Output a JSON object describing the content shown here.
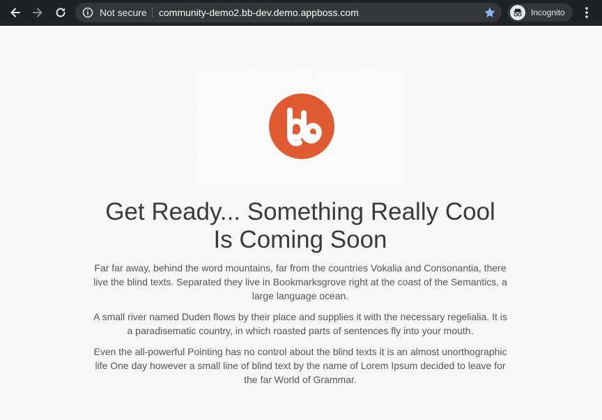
{
  "browser": {
    "security_label": "Not secure",
    "url": "community-demo2.bb-dev.demo.appboss.com",
    "profile_label": "Incognito"
  },
  "page": {
    "headline_line1": "Get Ready... Something Really Cool",
    "headline_line2": "Is Coming Soon",
    "paragraphs": [
      "Far far away, behind the word mountains, far from the countries Vokalia and Consonantia, there live the blind texts. Separated they live in Bookmarksgrove right at the coast of the Semantics, a large language ocean.",
      "A small river named Duden flows by their place and supplies it with the necessary regelialia. It is a paradisematic country, in which roasted parts of sentences fly into your mouth.",
      "Even the all-powerful Pointing has no control about the blind texts it is an almost unorthographic life One day however a small line of blind text by the name of Lorem Ipsum decided to leave for the far World of Grammar."
    ]
  },
  "colors": {
    "brand": "#e15b32",
    "chrome": "#202124",
    "omnibox": "#35363a",
    "star": "#8ab4f8"
  },
  "icons": {
    "back": "arrow-left-icon",
    "forward": "arrow-right-icon",
    "reload": "reload-icon",
    "info": "info-icon",
    "bookmark": "star-icon",
    "profile": "incognito-icon",
    "menu": "kebab-menu-icon",
    "logo": "buddyboss-logo-icon"
  }
}
